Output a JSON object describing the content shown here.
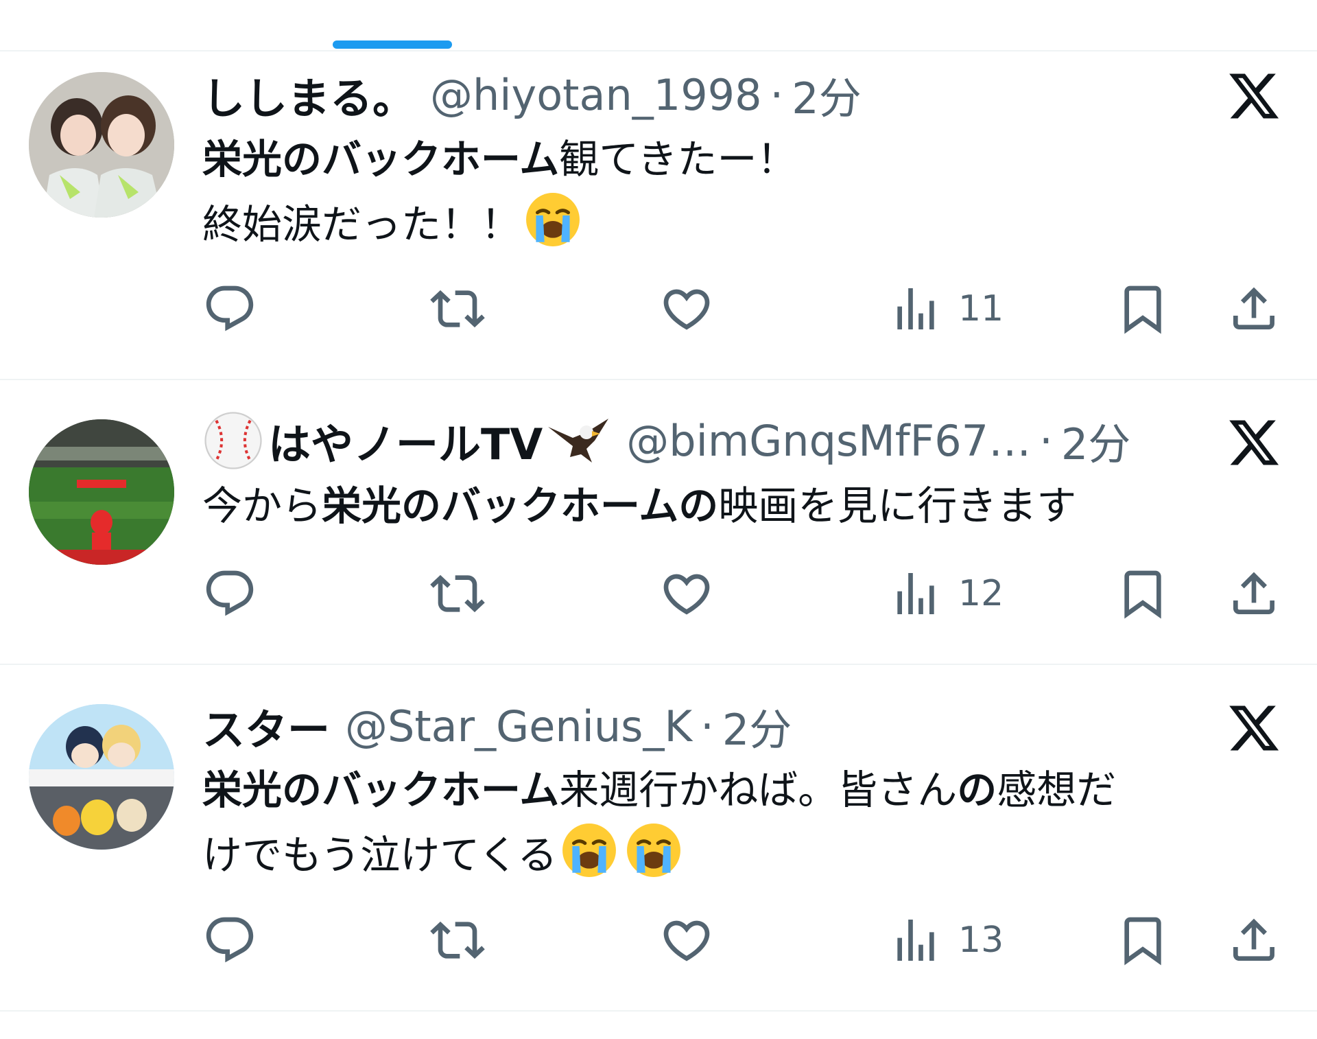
{
  "colors": {
    "accent": "#1d9bf0",
    "text": "#0f1419",
    "secondary": "#536471",
    "divider": "#eff3f4"
  },
  "tweets": [
    {
      "display_name": "ししまる。",
      "handle": "@hiyotan_1998",
      "separator": "·",
      "time": "2分",
      "body_line1_bold": "栄光のバックホーム",
      "body_line1_rest": "観てきたー！",
      "body_line2": "終始涙だった！！",
      "body_line2_emoji": "loudly-crying-face",
      "views": "11",
      "avatar_icon": "avatar-photo-two-girls"
    },
    {
      "display_name_emoji": "baseball",
      "display_name": "はやノールTV",
      "display_name_emoji2": "eagle",
      "handle": "@bimGnqsMfF67…",
      "separator": "·",
      "time": "2分",
      "body_pre": "今から",
      "body_bold": "栄光のバックホームの",
      "body_post": "映画を見に行きます",
      "views": "12",
      "avatar_icon": "avatar-photo-stadium"
    },
    {
      "display_name": "スター",
      "handle": "@Star_Genius_K",
      "separator": "·",
      "time": "2分",
      "body_line1_bold": "栄光のバックホーム",
      "body_line1_rest": "来週行かねば。皆さん",
      "body_line1_bold2": "の",
      "body_line1_rest2": "感想だ",
      "body_line2": "けでもう泣けてくる",
      "body_line2_emoji": "loudly-crying-face",
      "views": "13",
      "avatar_icon": "avatar-photo-plush-toys"
    }
  ],
  "icons": [
    "reply-icon",
    "retweet-icon",
    "like-icon",
    "views-icon",
    "bookmark-icon",
    "share-icon",
    "x-logo-icon"
  ]
}
